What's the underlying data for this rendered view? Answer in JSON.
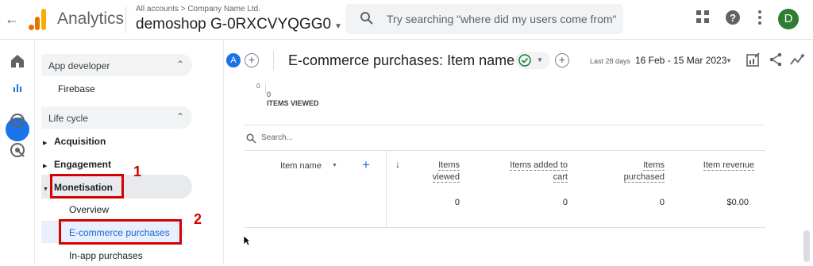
{
  "topbar": {
    "app_name": "Analytics",
    "breadcrumb": "All accounts > Company Name Ltd.",
    "property": "demoshop G-0RXCVYQGG0",
    "search_placeholder": "Try searching \"where did my users come from\"",
    "avatar_letter": "D",
    "avatar_color": "#2e7d32"
  },
  "sidebar": {
    "section_app_developer": "App developer",
    "item_firebase": "Firebase",
    "section_life_cycle": "Life cycle",
    "item_acquisition": "Acquisition",
    "item_engagement": "Engagement",
    "item_monetisation": "Monetisation",
    "item_overview": "Overview",
    "item_ecommerce": "E-commerce purchases",
    "item_inapp": "In-app purchases"
  },
  "annotations": {
    "num1": "1",
    "num2": "2",
    "color": "#d50000"
  },
  "report": {
    "comparison_chip": "A",
    "title": "E-commerce purchases: Item name",
    "range_label": "Last 28 days",
    "range_value": "16 Feb - 15 Mar 2023"
  },
  "chart_stub": {
    "zero_label": "0",
    "items_viewed_value": "0",
    "items_viewed_label": "ITEMS VIEWED"
  },
  "table": {
    "search_placeholder": "Search...",
    "dimension_header": "Item name",
    "columns": [
      {
        "line1": "Items",
        "line2": "viewed"
      },
      {
        "line1": "Items added to",
        "line2": "cart"
      },
      {
        "line1": "Items",
        "line2": "purchased"
      },
      {
        "line1": "Item revenue",
        "line2": ""
      }
    ],
    "totals": [
      "0",
      "0",
      "0",
      "$0.00"
    ]
  }
}
